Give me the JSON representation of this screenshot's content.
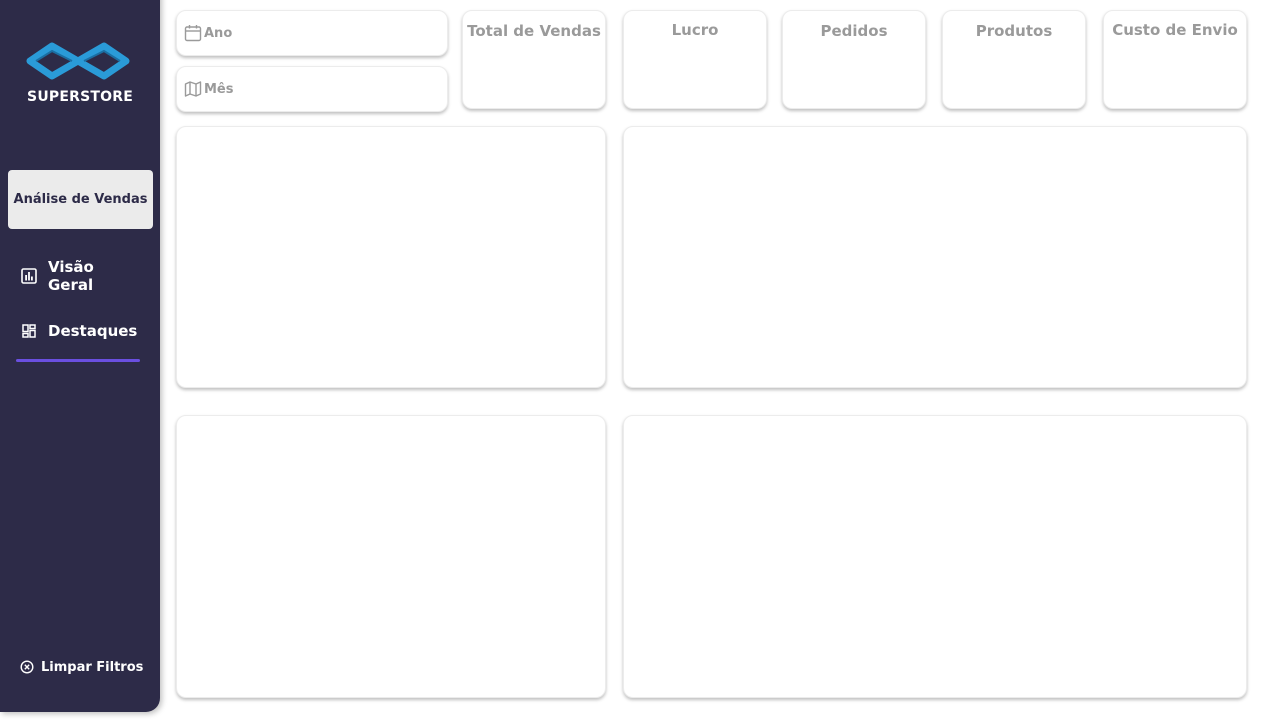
{
  "brand": {
    "name": "SUPERSTORE",
    "logo_icon": "infinity-logo-icon",
    "logo_color": "#2a9bd8"
  },
  "sidebar": {
    "section_label": "Análise de Vendas",
    "nav": [
      {
        "label": "Visão Geral",
        "icon": "bar-chart-icon"
      },
      {
        "label": "Destaques",
        "icon": "dashboard-grid-icon"
      }
    ],
    "active_index": 1,
    "accent_color": "#6a4fe0",
    "background": "#2d2b48",
    "clear_filters": {
      "label": "Limpar Filtros",
      "icon": "close-circle-icon"
    }
  },
  "filters": {
    "year": {
      "label": "Ano",
      "icon": "calendar-icon"
    },
    "month": {
      "label": "Mês",
      "icon": "map-icon"
    }
  },
  "kpis": [
    {
      "title": "Total de Vendas"
    },
    {
      "title": "Lucro"
    },
    {
      "title": "Pedidos"
    },
    {
      "title": "Produtos"
    },
    {
      "title": "Custo de Envio"
    }
  ]
}
